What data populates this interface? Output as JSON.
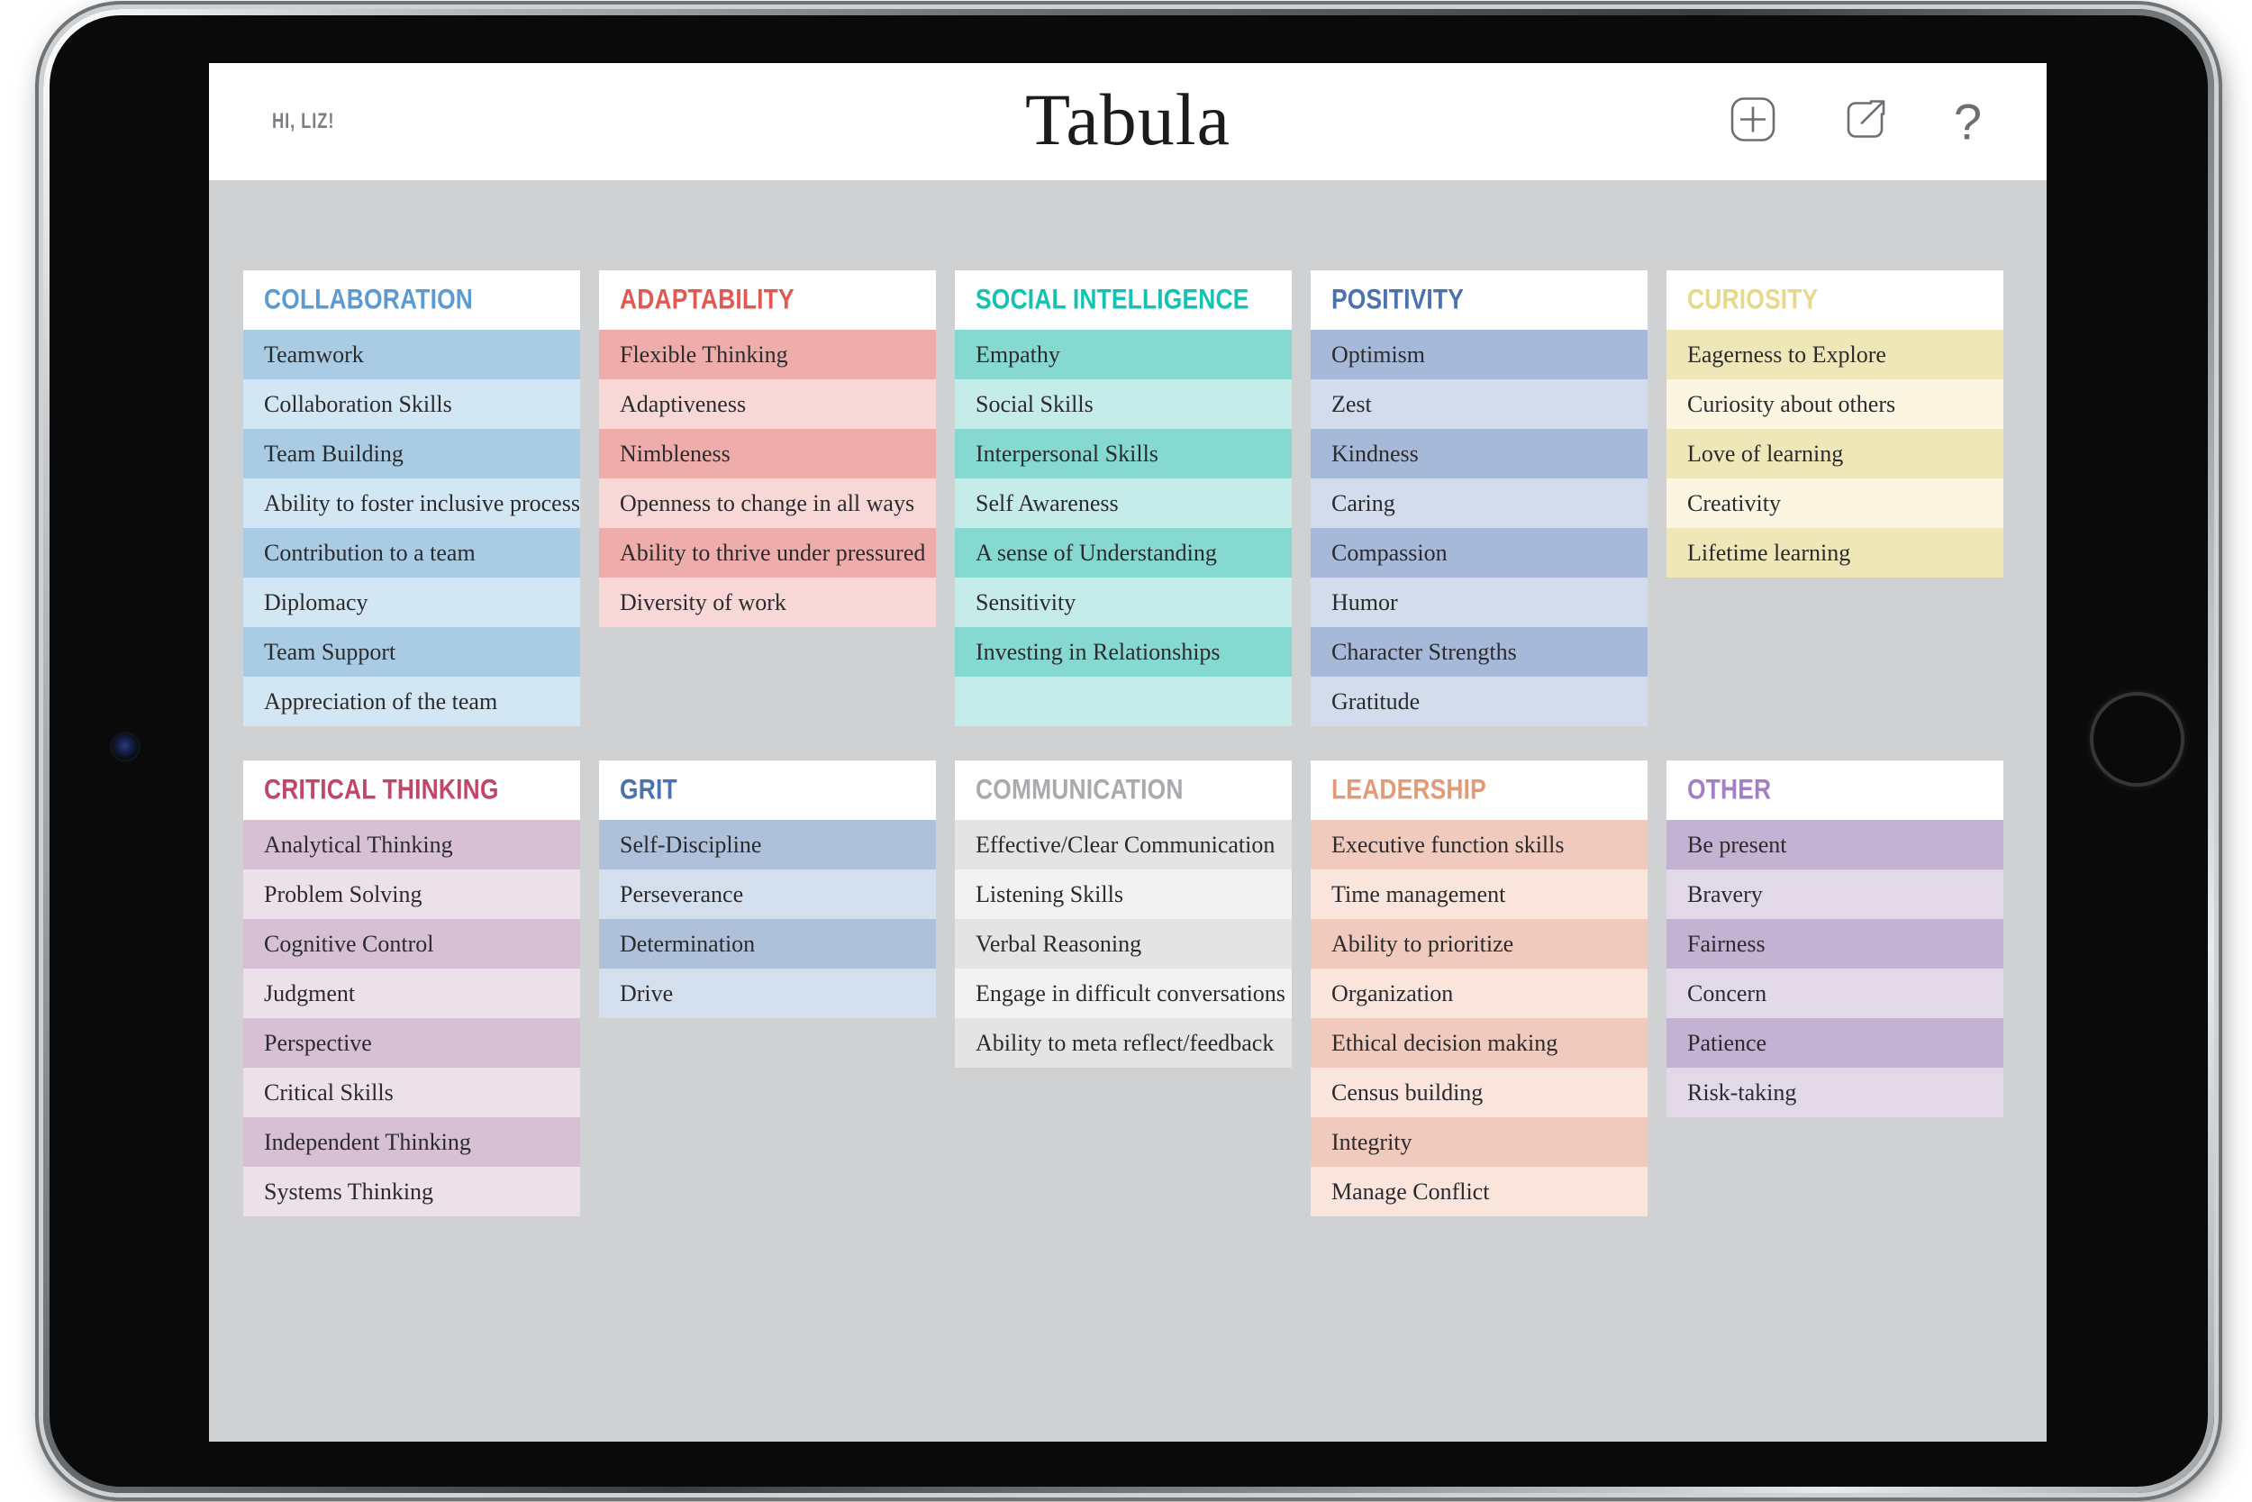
{
  "header": {
    "greeting": "HI, LIZ!",
    "title": "Tabula",
    "actions": [
      {
        "name": "add-icon",
        "label": "Add"
      },
      {
        "name": "share-icon",
        "label": "Share"
      },
      {
        "name": "help-icon",
        "label": "?"
      }
    ]
  },
  "colors": {
    "screen_background": "#d0d1d3",
    "header_background": "#ffffff",
    "card_header_background": "#ffffff",
    "row_text": "#2b2b2e",
    "greeting_text": "#7b7f83",
    "title_text": "#1c1c1c",
    "icon_stroke": "#6b6f73"
  },
  "board": {
    "rows": [
      {
        "cards": [
          {
            "title": "COLLABORATION",
            "title_color": "#5b9bd1",
            "shade_dark": "#a9cce4",
            "shade_light": "#d3e6f3",
            "items": [
              "Teamwork",
              "Collaboration Skills",
              "Team Building",
              "Ability to foster inclusive process",
              "Contribution to a team",
              "Diplomacy",
              "Team Support",
              "Appreciation of the team"
            ]
          },
          {
            "title": "ADAPTABILITY",
            "title_color": "#e05a52",
            "shade_dark": "#eeadab",
            "shade_light": "#f7d8d7",
            "items": [
              "Flexible Thinking",
              "Adaptiveness",
              "Nimbleness",
              "Openness to change in all ways",
              "Ability to thrive under pressured",
              "Diversity of work"
            ]
          },
          {
            "title": "SOCIAL INTELLIGENCE",
            "title_color": "#13c2b0",
            "shade_dark": "#86d9d1",
            "shade_light": "#c6ecea",
            "items": [
              "Empathy",
              "Social Skills",
              "Interpersonal Skills",
              "Self Awareness",
              "A sense of Understanding",
              "Sensitivity",
              "Investing in Relationships",
              ""
            ]
          },
          {
            "title": "POSITIVITY",
            "title_color": "#4a72ae",
            "shade_dark": "#a7b9d8",
            "shade_light": "#d2dced",
            "items": [
              "Optimism",
              "Zest",
              "Kindness",
              "Caring",
              "Compassion",
              "Humor",
              "Character Strengths",
              "Gratitude"
            ]
          },
          {
            "title": "CURIOSITY",
            "title_color": "#e8d98a",
            "shade_dark": "#f0e7b9",
            "shade_light": "#fbf5e2",
            "items": [
              "Eagerness to Explore",
              "Curiosity about others",
              "Love of learning",
              "Creativity",
              "Lifetime learning"
            ]
          }
        ]
      },
      {
        "cards": [
          {
            "title": "CRITICAL THINKING",
            "title_color": "#c0466a",
            "shade_dark": "#d7c0d3",
            "shade_light": "#ece0e9",
            "items": [
              "Analytical Thinking",
              "Problem Solving",
              "Cognitive Control",
              "Judgment",
              "Perspective",
              "Critical Skills",
              "Independent Thinking",
              "Systems Thinking"
            ]
          },
          {
            "title": "GRIT",
            "title_color": "#4a72ae",
            "shade_dark": "#aec0da",
            "shade_light": "#d4dfee",
            "items": [
              "Self-Discipline",
              "Perseverance",
              "Determination",
              "Drive"
            ]
          },
          {
            "title": "COMMUNICATION",
            "title_color": "#a8aaad",
            "shade_dark": "#e4e4e5",
            "shade_light": "#f2f2f3",
            "items": [
              "Effective/Clear Communication",
              "Listening Skills",
              "Verbal Reasoning",
              "Engage in difficult conversations",
              "Ability to meta reflect/feedback"
            ]
          },
          {
            "title": "LEADERSHIP",
            "title_color": "#e09b78",
            "shade_dark": "#f0cbbd",
            "shade_light": "#fae5dd",
            "items": [
              "Executive function skills",
              "Time management",
              "Ability to prioritize",
              "Organization",
              "Ethical decision making",
              "Census building",
              "Integrity",
              "Manage Conflict"
            ]
          },
          {
            "title": "OTHER",
            "title_color": "#a57fc4",
            "shade_dark": "#c4b2d2",
            "shade_light": "#e1d8e8",
            "items": [
              "Be present",
              "Bravery",
              "Fairness",
              "Concern",
              "Patience",
              "Risk-taking"
            ]
          }
        ]
      }
    ]
  }
}
